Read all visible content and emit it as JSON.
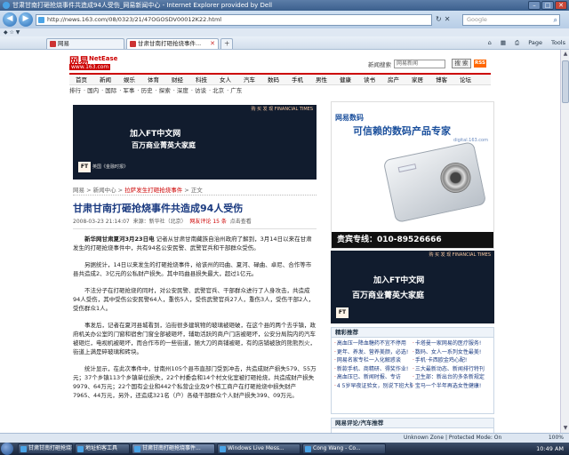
{
  "browser": {
    "title": "甘肃甘南打砸抢烧事件共造成94人受伤_网易新闻中心 - Internet Explorer provided by Dell",
    "url": "http://news.163.com/08/0323/21/47OGOSDV00012K22.html",
    "search_placeholder": "Google",
    "links_label": "◆ ☆ ▼",
    "tabs": [
      {
        "label": "网易"
      },
      {
        "label": "甘肃甘南打砸抢烧事件..."
      }
    ],
    "toolbar": {
      "home": "⌂",
      "feeds": "▦",
      "print": "⎙",
      "page": "Page",
      "tools": "Tools"
    }
  },
  "site": {
    "logo_cn": "网易",
    "logo_en": "NetEase",
    "logo_url": "www.163.com",
    "search_label": "新闻搜索",
    "search_value": "网易新闻",
    "search_button": "搜 索",
    "rss": "RSS",
    "channels": [
      "首页",
      "新闻",
      "娱乐",
      "体育",
      "财经",
      "科技",
      "女人",
      "汽车",
      "数码",
      "手机",
      "男性",
      "健康",
      "读书",
      "房产",
      "家居",
      "博客",
      "论坛"
    ],
    "subnav": [
      "排行",
      "国内",
      "国际",
      "军事",
      "历史",
      "探索",
      "深度",
      "访谈",
      "北京",
      "广东"
    ]
  },
  "ad_left": {
    "tag": "购 买 发 现 FINANCIAL TIMES",
    "line1": "加入FT中文网",
    "line2": "百万商业菁英大家庭",
    "ft": "FT",
    "ft_sub": "英国《金融时报》"
  },
  "article": {
    "breadcrumb": [
      "网易",
      "新闻中心",
      "拉萨发生打砸抢烧事件",
      "正文"
    ],
    "headline": "甘肃甘南打砸抢烧事件共造成94人受伤",
    "date": "2008-03-23 21:14:07",
    "source_label": "来源：",
    "source": "新华社（北京）",
    "comments_label": "网友评论",
    "comments": "15 条",
    "click_label": "点击查看",
    "paragraphs": [
      {
        "lead": "新华网甘肃夏河3月23日电",
        "text": "记者从甘肃甘南藏族自治州政府了解到，3月14日以来在甘肃发生的打砸抢烧事件中，共有94名公安民警、武警官兵和干部群众受伤。"
      },
      {
        "lead": "",
        "text": "另据统计，14日以来发生的打砸抢烧事件，给该州的玛曲、夏河、碌曲、卓尼、合作等市县共造成2、3亿元的公私财产损失。其中玛曲县损失最大，超过1亿元。"
      },
      {
        "lead": "",
        "text": "不法分子在打砸抢烧的同时，对公安民警、武警官兵、干部群众进行了人身攻击，共造成94人受伤，其中受伤公安民警64人，重伤5人，受伤武警官兵27人，重伤3人，受伤干部2人，受伤群众1人。"
      },
      {
        "lead": "",
        "text": "事发后，记者在夏河县城看到，沿街很多建筑物的玻璃被砸破，在这个县的两个去乎镇，政府机关办公室的门窗和宿舍门窗全部被砸坏，辅助活跃的商户门店被砸坏，公安分局院内的汽车被砸烂，电视机被砸坏，而合作市的一些街道，随大刀的商铺被砸，有的店铺被放的熊熊烈火，街道上满是碎玻璃和砖块。"
      },
      {
        "lead": "",
        "text": "统计显示，在此次事件中，甘南州105个县市直部门受到冲击，共造成财产损失579、55万元；37个乡镇113个乡镇单位损失，22个村委会和14个村文化室被打砸抢烧，共造成财产损失9979、64万元；22个国有企业和442个私营企业及9个核工商户在打砸抢烧中损失财产7965、44万元，另外，还造成321名（户）各级干部群众个人财产损失399、09万元。"
      }
    ]
  },
  "ad_camera": {
    "brand": "网易数码",
    "slogan": "可信赖的数码产品专家",
    "small": "digital.163.com",
    "hotline": "贵宾专线：010-89526666"
  },
  "ad_right": {
    "tag": "购 买 发 现 FINANCIAL TIMES",
    "line1": "加入FT中文网",
    "line2": "百万商业菁英大家庭",
    "ft": "FT"
  },
  "news_box": {
    "title": "精彩推荐",
    "items": [
      "高血压一降血糖药不宜不停用",
      "卡塔曼一家网易的医疗服务!",
      "更年、养发、营养美颜，必选!",
      "数码、女人一系列女性最美!",
      "网易名家专栏一入化解惑谈",
      "手机·卡西欧金鸡心配!",
      "新款手机、商精研、得奖作业!",
      "三大最新动态、新闻排行特刊",
      "高血压已、新闻时报、专访",
      "卫生部：新出台的多条新规定",
      "4 5岁早夜证验女，别说下班大脑",
      "宝马一个半年再选女性健康!"
    ]
  },
  "auto_box": {
    "title": "网易评论/汽车推荐"
  },
  "status": {
    "zone": "Unknown Zone | Protected Mode: On",
    "zoom": "100%"
  },
  "taskbar": {
    "items": [
      "甘肃甘南打砸抢烧事件...",
      "地址拍客工具",
      "甘肃甘南打砸抢烧事件...",
      "Windows Live Mess...",
      "Cong Wang - Co..."
    ],
    "clock": "10:49 AM"
  }
}
